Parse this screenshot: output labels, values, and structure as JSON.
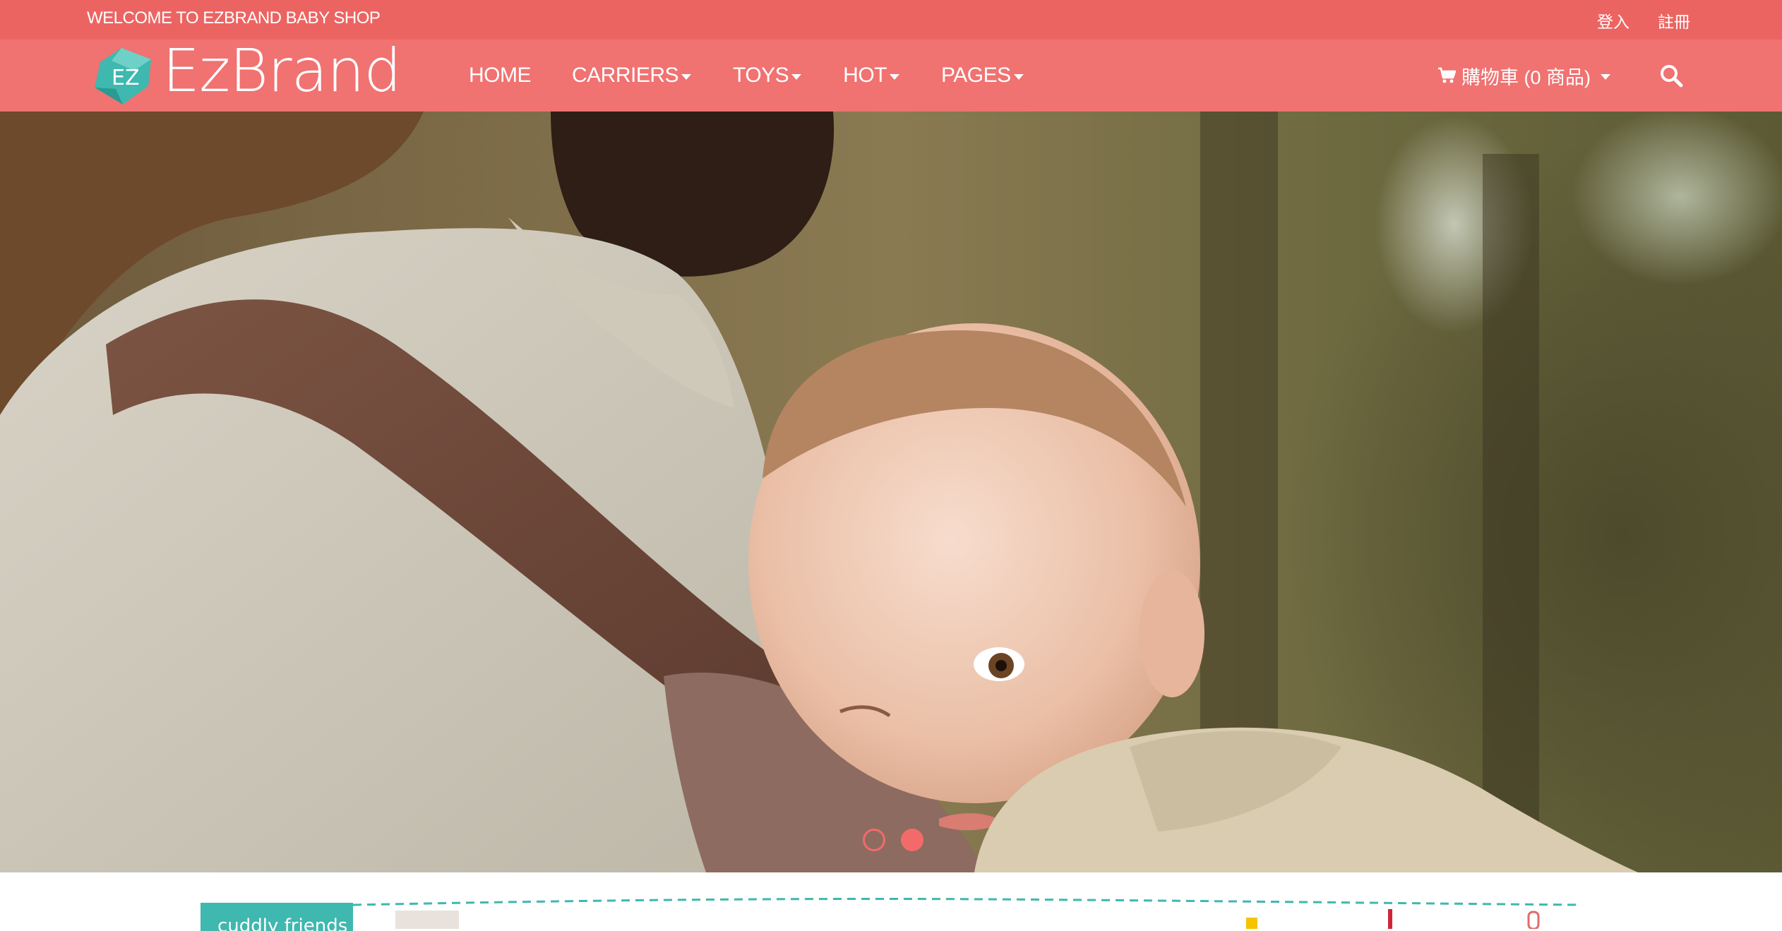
{
  "topbar": {
    "welcome": "WELCOME TO EZBRAND BABY SHOP",
    "login": "登入",
    "register": "註冊"
  },
  "brand": {
    "name": "EzBrand",
    "mark": "EZ"
  },
  "menu": {
    "home": "HOME",
    "carriers": "CARRIERS",
    "toys": "TOYS",
    "hot": "HOT",
    "pages": "PAGES"
  },
  "cart": {
    "label": "購物車 (0 商品)",
    "icon": "shopping-cart-icon"
  },
  "search": {
    "icon": "search-icon"
  },
  "slider": {
    "slide_count": 2,
    "active_index": 1,
    "image": "father carrying sleeping baby in carrier, forest background"
  },
  "teaser": {
    "tag": "cuddly friends"
  },
  "colors": {
    "topbar_bg": "#ec6462",
    "navbar_bg": "#f07271",
    "accent": "#f26b6a",
    "logo_teal": "#3fb8af",
    "teaser_teal": "#3fb8af"
  }
}
